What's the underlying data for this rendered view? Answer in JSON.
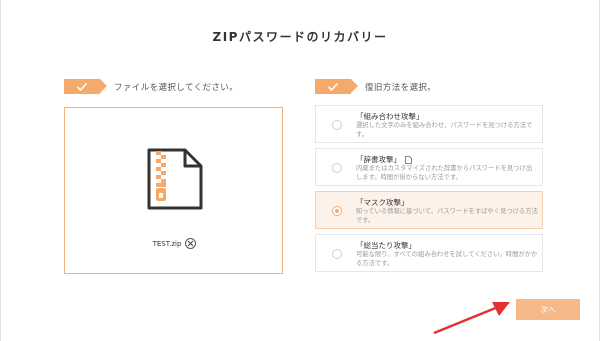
{
  "title": "ZIPパスワードのリカバリー",
  "step1": {
    "label": "ファイルを選択してください。"
  },
  "step2": {
    "label": "復旧方法を選択。"
  },
  "file": {
    "name": "TEST.zip"
  },
  "methods": [
    {
      "title": "「組み合わせ攻撃」",
      "desc": "選択した文字のみを組み合わせ、パスワードを見つける方法です。",
      "selected": false
    },
    {
      "title": "「辞書攻撃」",
      "desc": "内蔵またはカスタマイズされた辞書からパスワードを見つけ出します。時間が掛からない方法です。",
      "selected": false
    },
    {
      "title": "「マスク攻撃」",
      "desc": "知っている情報に基づいて、パスワードをすばやく見つける方法です。",
      "selected": true
    },
    {
      "title": "「総当たり攻撃」",
      "desc": "可能な限り、すべての組み合わせを試してください。時間がかかる方法です。",
      "selected": false
    }
  ],
  "next_button": {
    "label": "次へ"
  },
  "colors": {
    "accent": "#f5a96b",
    "button": "#f5b98a",
    "arrow": "#e53030"
  }
}
